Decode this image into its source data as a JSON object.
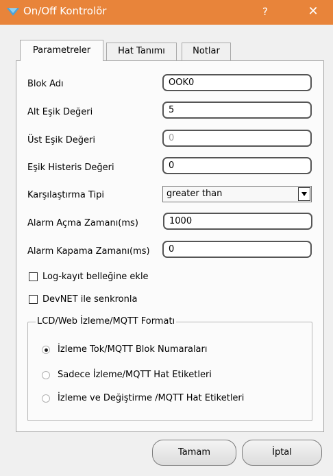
{
  "window": {
    "title": "On/Off Kontrolör",
    "help_label": "?",
    "close_label": "✕",
    "accent_color": "#e8843a"
  },
  "tabs": [
    {
      "label": "Parametreler",
      "active": true
    },
    {
      "label": "Hat Tanımı",
      "active": false
    },
    {
      "label": "Notlar",
      "active": false
    }
  ],
  "form": {
    "block_name": {
      "label": "Blok Adı",
      "value": "OOK0"
    },
    "lower_threshold": {
      "label": "Alt Eşik Değeri",
      "value": "5"
    },
    "upper_threshold": {
      "label": "Üst Eşik Değeri",
      "value": "0",
      "disabled": true
    },
    "hysteresis": {
      "label": "Eşik Histeris Değeri",
      "value": "0"
    },
    "compare_type": {
      "label": "Karşılaştırma Tipi",
      "value": "greater than"
    },
    "alarm_open_time": {
      "label": "Alarm Açma Zamanı(ms)",
      "value": "1000"
    },
    "alarm_close_time": {
      "label": "Alarm Kapama Zamanı(ms)",
      "value": "0"
    }
  },
  "checkboxes": {
    "log": {
      "label": "Log-kayıt belleğine ekle",
      "checked": false
    },
    "devnet": {
      "label": "DevNET ile senkronla",
      "checked": false
    }
  },
  "format_group": {
    "title": "LCD/Web İzleme/MQTT Formatı",
    "options": [
      {
        "label": "İzleme Tok/MQTT Blok Numaraları",
        "checked": true
      },
      {
        "label": "Sadece İzleme/MQTT Hat Etiketleri",
        "checked": false
      },
      {
        "label": "İzleme ve Değiştirme /MQTT Hat Etiketleri",
        "checked": false
      }
    ]
  },
  "buttons": {
    "ok": "Tamam",
    "cancel": "İptal"
  }
}
